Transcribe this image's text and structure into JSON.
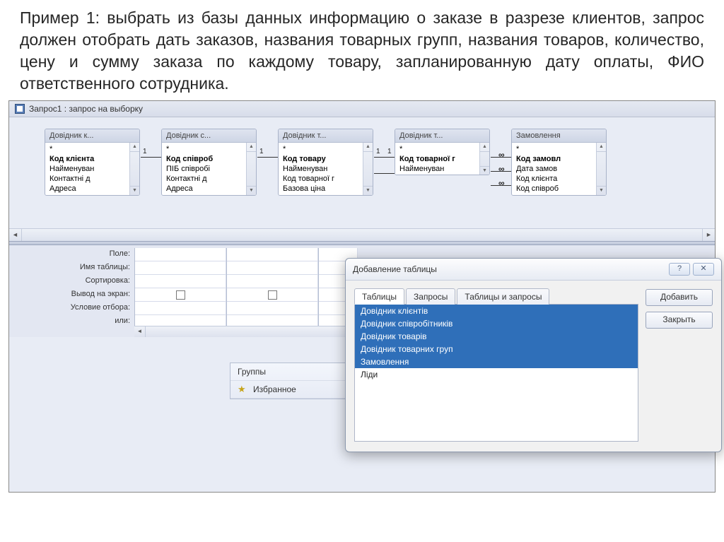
{
  "description": "Пример 1: выбрать из базы данных информацию о заказе в разрезе клиентов, запрос должен отобрать дать заказов, названия товарных групп, названия товаров, количество, цену и сумму заказа по каждому товару, запланированную дату оплаты, ФИО ответственного сотрудника.",
  "window": {
    "title": "Запрос1 : запрос на выборку"
  },
  "tables": [
    {
      "title": "Довідник к...",
      "fields": [
        "*",
        "Код клієнта",
        "Найменуван",
        "Контактні д",
        "Адреса"
      ]
    },
    {
      "title": "Довідник с...",
      "fields": [
        "*",
        "Код співроб",
        "ПІБ співробі",
        "Контактні д",
        "Адреса"
      ]
    },
    {
      "title": "Довідник т...",
      "fields": [
        "*",
        "Код товару",
        "Найменуван",
        "Код товарної г",
        "Базова ціна"
      ]
    },
    {
      "title": "Довідник т...",
      "fields": [
        "*",
        "Код товарної г",
        "Найменуван"
      ]
    },
    {
      "title": "Замовлення",
      "fields": [
        "*",
        "Код замовл",
        "Дата замов",
        "Код клієнта",
        "Код співроб"
      ]
    }
  ],
  "relations_labels": {
    "one": "1",
    "many": "∞"
  },
  "grid": {
    "labels": [
      "Поле:",
      "Имя таблицы:",
      "Сортировка:",
      "Вывод на экран:",
      "Условие отбора:",
      "или:"
    ]
  },
  "sidebar": {
    "groups": "Группы",
    "favorites": "Избранное"
  },
  "dialog": {
    "title": "Добавление таблицы",
    "tabs": [
      "Таблицы",
      "Запросы",
      "Таблицы и запросы"
    ],
    "items": [
      "Довідник клієнтів",
      "Довідник співробітників",
      "Довідник товарів",
      "Довідник товарних груп",
      "Замовлення",
      "Ліди"
    ],
    "selected_count": 5,
    "buttons": {
      "add": "Добавить",
      "close": "Закрыть"
    },
    "help_glyph": "?",
    "close_glyph": "✕"
  }
}
